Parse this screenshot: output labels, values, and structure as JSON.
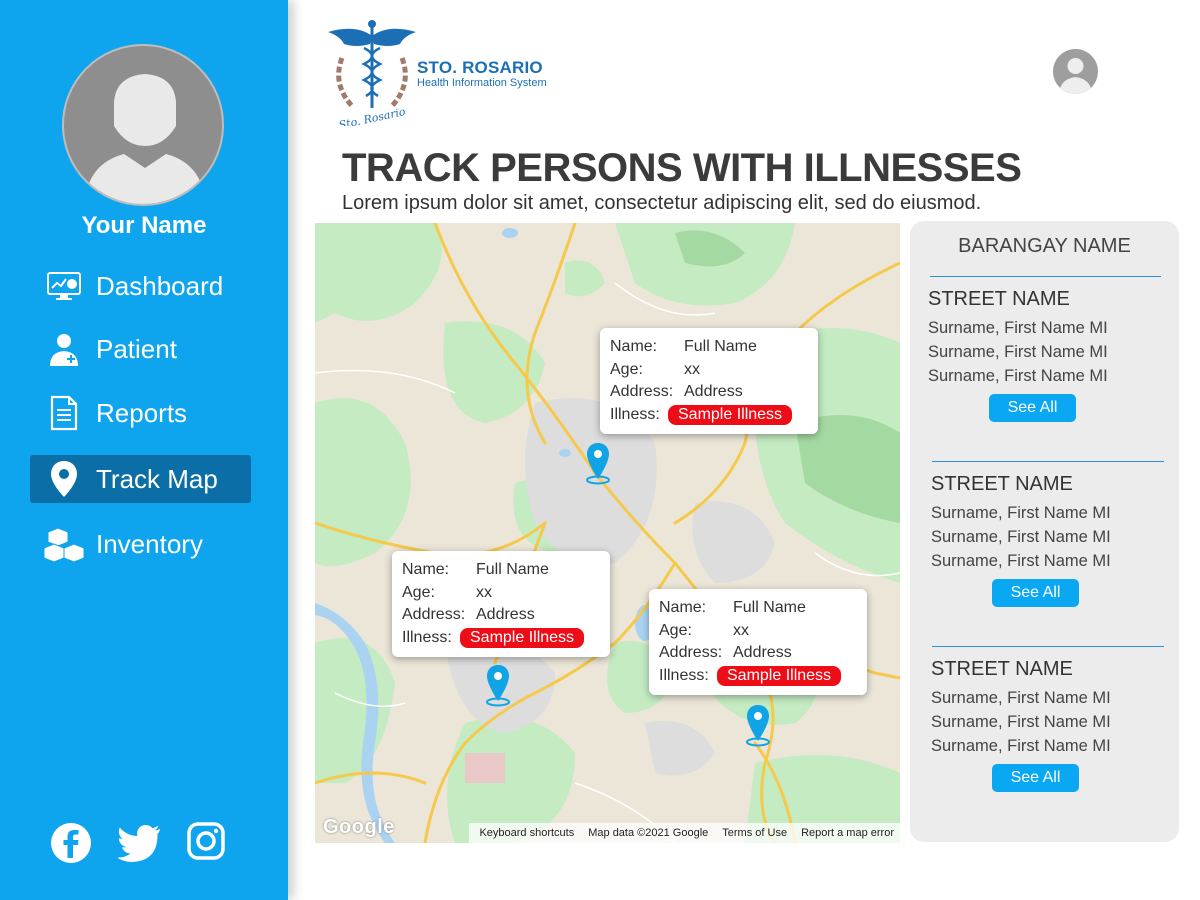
{
  "sidebar": {
    "user_name": "Your Name",
    "nav": [
      {
        "label": "Dashboard",
        "icon": "dashboard-icon",
        "active": false
      },
      {
        "label": "Patient",
        "icon": "patient-icon",
        "active": false
      },
      {
        "label": "Reports",
        "icon": "reports-icon",
        "active": false
      },
      {
        "label": "Track Map",
        "icon": "map-pin-icon",
        "active": true
      },
      {
        "label": "Inventory",
        "icon": "boxes-icon",
        "active": false
      }
    ],
    "social": [
      "facebook-icon",
      "twitter-icon",
      "instagram-icon"
    ]
  },
  "header": {
    "brand_title": "STO. ROSARIO",
    "brand_subtitle": "Health Information System",
    "logo_text": "Sto. Rosario"
  },
  "page": {
    "title": "TRACK PERSONS WITH ILLNESSES",
    "subtitle": "Lorem ipsum dolor sit amet, consectetur adipiscing elit, sed do eiusmod."
  },
  "map": {
    "google_logo": "Google",
    "footer": [
      "Keyboard shortcuts",
      "Map data ©2021 Google",
      "Terms of Use",
      "Report a map error"
    ],
    "cards": [
      {
        "name_key": "Name:",
        "name": "Full Name",
        "age_key": "Age:",
        "age": "xx",
        "address_key": "Address:",
        "address": "Address",
        "illness_key": "Illness:",
        "illness": "Sample Illness"
      },
      {
        "name_key": "Name:",
        "name": "Full Name",
        "age_key": "Age:",
        "age": "xx",
        "address_key": "Address:",
        "address": "Address",
        "illness_key": "Illness:",
        "illness": "Sample Illness"
      },
      {
        "name_key": "Name:",
        "name": "Full Name",
        "age_key": "Age:",
        "age": "xx",
        "address_key": "Address:",
        "address": "Address",
        "illness_key": "Illness:",
        "illness": "Sample Illness"
      }
    ]
  },
  "panel": {
    "title": "BARANGAY NAME",
    "streets": [
      {
        "name": "STREET NAME",
        "persons": [
          "Surname, First Name MI",
          "Surname, First Name MI",
          "Surname, First Name MI"
        ],
        "button": "See All"
      },
      {
        "name": "STREET NAME",
        "persons": [
          "Surname, First Name MI",
          "Surname, First Name MI",
          "Surname, First Name MI"
        ],
        "button": "See All"
      },
      {
        "name": "STREET NAME",
        "persons": [
          "Surname, First Name MI",
          "Surname, First Name MI",
          "Surname, First Name MI"
        ],
        "button": "See All"
      }
    ]
  },
  "colors": {
    "sidebar": "#0fa5ee",
    "active_nav": "#0b6ea6",
    "brand": "#1d6fb5",
    "illness_badge": "#ee0c17",
    "see_all_button": "#0aa8f2",
    "pin": "#10a3e6"
  }
}
